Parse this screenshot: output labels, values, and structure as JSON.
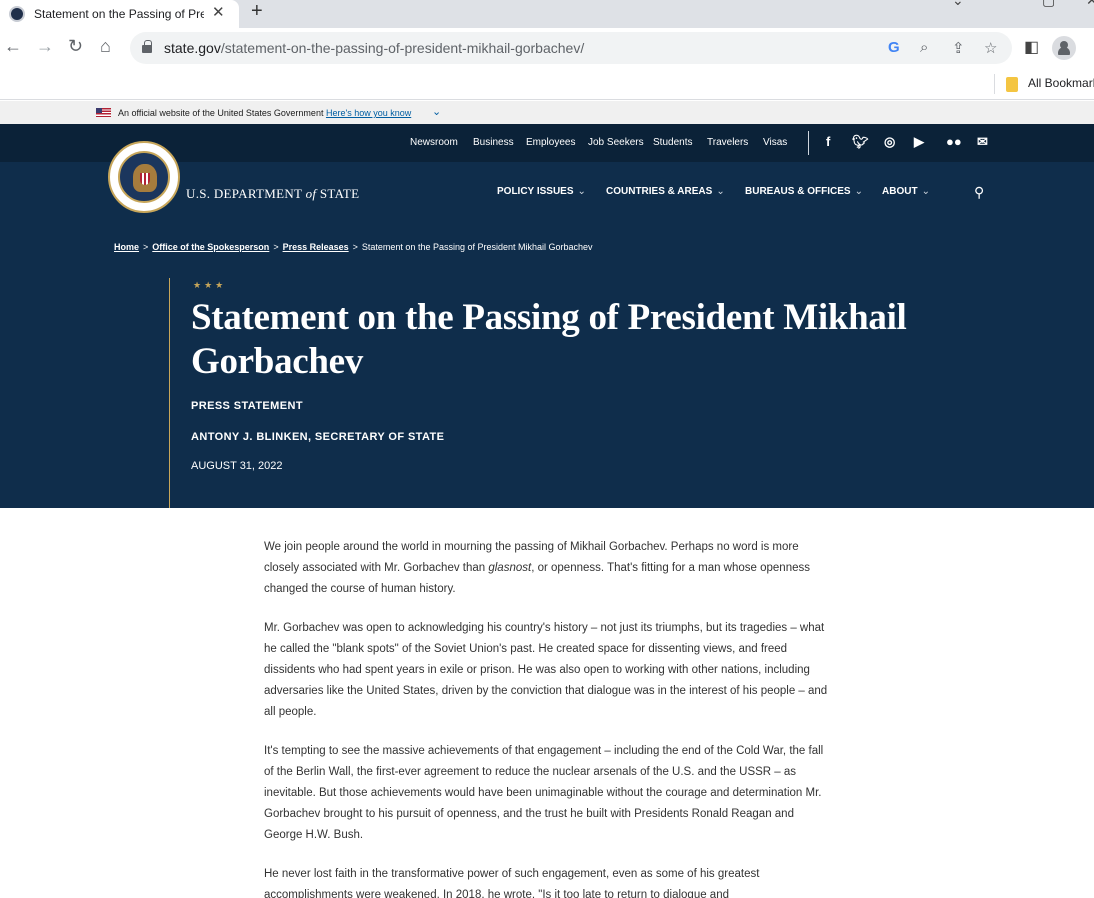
{
  "browser": {
    "tab_title": "Statement on the Passing of Pres",
    "tab_close": "✕",
    "new_tab": "+",
    "url_host": "state.gov",
    "url_path": "/statement-on-the-passing-of-president-mikhail-gorbachev/",
    "bookmarks_label": "All Bookmarks"
  },
  "gov_banner": {
    "text": "An official website of the United States Government",
    "link": "Here's how you know"
  },
  "utility_nav": [
    "Newsroom",
    "Business",
    "Employees",
    "Job Seekers",
    "Students",
    "Travelers",
    "Visas"
  ],
  "social_icons": [
    "facebook-icon",
    "twitter-icon",
    "instagram-icon",
    "youtube-icon",
    "flickr-icon",
    "email-icon"
  ],
  "site": {
    "dept_name_pre": "U.S. DEPARTMENT",
    "dept_name_of": "of",
    "dept_name_post": "STATE",
    "main_nav": [
      "POLICY ISSUES",
      "COUNTRIES & AREAS",
      "BUREAUS & OFFICES",
      "ABOUT"
    ]
  },
  "breadcrumb": {
    "home": "Home",
    "office": "Office of the Spokesperson",
    "press": "Press Releases",
    "current": "Statement on the Passing of President Mikhail Gorbachev",
    "separator": ">"
  },
  "hero": {
    "stars": "★★★",
    "title": "Statement on the Passing of President Mikhail Gorbachev",
    "type": "PRESS STATEMENT",
    "author": "ANTONY J. BLINKEN, SECRETARY OF STATE",
    "date": "AUGUST 31, 2022"
  },
  "article": {
    "p1_a": "We join people around the world in mourning the passing of Mikhail Gorbachev. Perhaps no word is more closely associated with Mr. Gorbachev than ",
    "p1_em": "glasnost",
    "p1_b": ", or openness. That's fitting for a man whose openness changed the course of human history.",
    "p2": "Mr. Gorbachev was open to acknowledging his country's history – not just its triumphs, but its tragedies – what he called the \"blank spots\" of the Soviet Union's past. He created space for dissenting views, and freed dissidents who had spent years in exile or prison. He was also open to working with other nations, including adversaries like the United States, driven by the conviction that dialogue was in the interest of his people – and all people.",
    "p3": "It's tempting to see the massive achievements of that engagement – including the end of the Cold War, the fall of the Berlin Wall, the first-ever agreement to reduce the nuclear arsenals of the U.S. and the USSR – as inevitable. But those achievements would have been unimaginable without the courage and determination Mr. Gorbachev brought to his pursuit of openness, and the trust he built with Presidents Ronald Reagan and George H.W. Bush.",
    "p4": "He never lost faith in the transformative power of such engagement, even as some of his greatest accomplishments were weakened. In 2018, he wrote, \"Is it too late to return to dialogue and"
  }
}
